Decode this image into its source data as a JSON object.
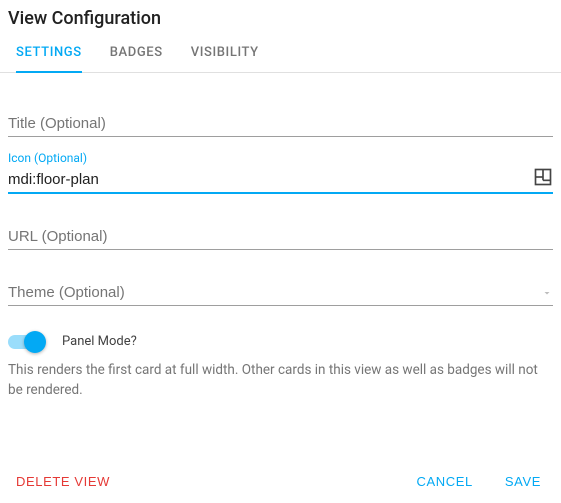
{
  "dialog": {
    "title": "View Configuration"
  },
  "tabs": {
    "settings": "SETTINGS",
    "badges": "BADGES",
    "visibility": "VISIBILITY"
  },
  "fields": {
    "title": {
      "label": "Title (Optional)",
      "value": ""
    },
    "icon": {
      "label": "Icon (Optional)",
      "value": "mdi:floor-plan"
    },
    "url": {
      "label": "URL (Optional)",
      "value": ""
    },
    "theme": {
      "label": "Theme (Optional)",
      "value": ""
    }
  },
  "panelMode": {
    "label": "Panel Mode?",
    "enabled": true,
    "help": "This renders the first card at full width. Other cards in this view as well as badges will not be rendered."
  },
  "actions": {
    "delete": "DELETE VIEW",
    "cancel": "CANCEL",
    "save": "SAVE"
  },
  "colors": {
    "accent": "#03a9f4",
    "danger": "#e53935"
  }
}
